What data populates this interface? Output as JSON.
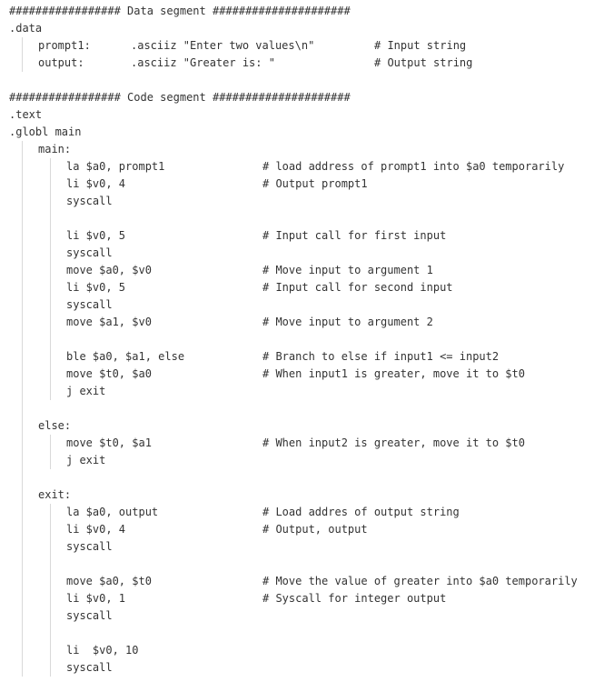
{
  "lines": [
    {
      "indent": 0,
      "code": "################# Data segment #####################"
    },
    {
      "indent": 0,
      "code": ".data"
    },
    {
      "indent": 1,
      "code": "prompt1:",
      "directive": ".asciiz \"Enter two values\\n\"",
      "comment": "# Input string"
    },
    {
      "indent": 1,
      "code": "output:",
      "directive": ".asciiz \"Greater is: \"",
      "comment": "# Output string"
    },
    {
      "indent": 0,
      "code": ""
    },
    {
      "indent": 0,
      "code": "################# Code segment #####################"
    },
    {
      "indent": 0,
      "code": ".text"
    },
    {
      "indent": 0,
      "code": ".globl main"
    },
    {
      "indent": 1,
      "code": "main:"
    },
    {
      "indent": 2,
      "code": "la $a0, prompt1",
      "comment": "# load address of prompt1 into $a0 temporarily"
    },
    {
      "indent": 2,
      "code": "li $v0, 4",
      "comment": "# Output prompt1"
    },
    {
      "indent": 2,
      "code": "syscall"
    },
    {
      "indent": 0,
      "code": ""
    },
    {
      "indent": 2,
      "code": "li $v0, 5",
      "comment": "# Input call for first input"
    },
    {
      "indent": 2,
      "code": "syscall"
    },
    {
      "indent": 2,
      "code": "move $a0, $v0",
      "comment": "# Move input to argument 1"
    },
    {
      "indent": 2,
      "code": "li $v0, 5",
      "comment": "# Input call for second input"
    },
    {
      "indent": 2,
      "code": "syscall"
    },
    {
      "indent": 2,
      "code": "move $a1, $v0",
      "comment": "# Move input to argument 2"
    },
    {
      "indent": 0,
      "code": ""
    },
    {
      "indent": 2,
      "code": "ble $a0, $a1, else",
      "comment": "# Branch to else if input1 <= input2"
    },
    {
      "indent": 2,
      "code": "move $t0, $a0",
      "comment": "# When input1 is greater, move it to $t0"
    },
    {
      "indent": 2,
      "code": "j exit"
    },
    {
      "indent": 0,
      "code": ""
    },
    {
      "indent": 1,
      "code": "else:"
    },
    {
      "indent": 2,
      "code": "move $t0, $a1",
      "comment": "# When input2 is greater, move it to $t0"
    },
    {
      "indent": 2,
      "code": "j exit"
    },
    {
      "indent": 0,
      "code": ""
    },
    {
      "indent": 1,
      "code": "exit:"
    },
    {
      "indent": 2,
      "code": "la $a0, output",
      "comment": "# Load addres of output string"
    },
    {
      "indent": 2,
      "code": "li $v0, 4",
      "comment": "# Output, output"
    },
    {
      "indent": 2,
      "code": "syscall"
    },
    {
      "indent": 0,
      "code": ""
    },
    {
      "indent": 2,
      "code": "move $a0, $t0",
      "comment": "# Move the value of greater into $a0 temporarily"
    },
    {
      "indent": 2,
      "code": "li $v0, 1",
      "comment": "# Syscall for integer output"
    },
    {
      "indent": 2,
      "code": "syscall"
    },
    {
      "indent": 0,
      "code": ""
    },
    {
      "indent": 2,
      "code": "li  $v0, 10"
    },
    {
      "indent": 2,
      "code": "syscall"
    }
  ]
}
